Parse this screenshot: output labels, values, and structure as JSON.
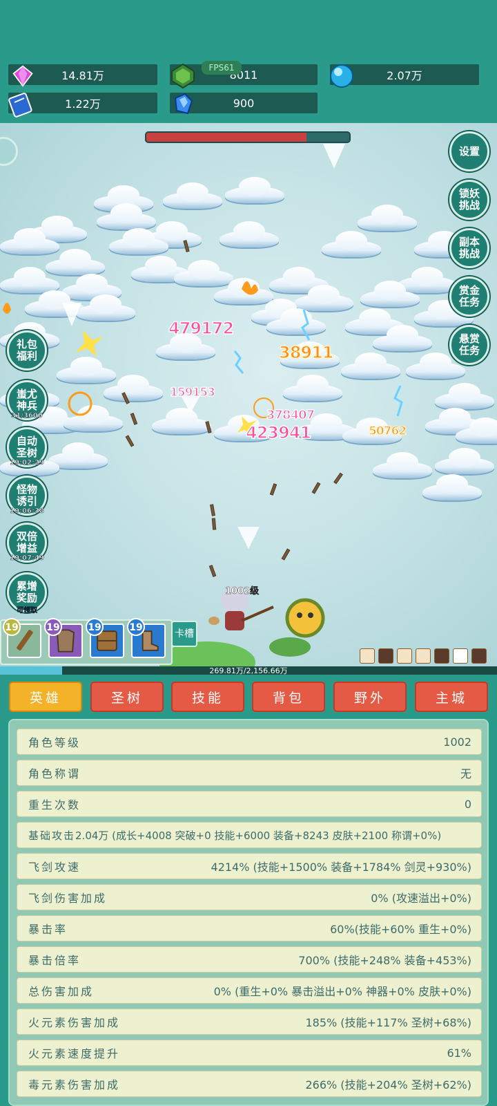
{
  "resources": [
    {
      "name": "diamond",
      "value": "14.81万",
      "icon": "gem-purple-icon"
    },
    {
      "name": "green-crystal",
      "value": "8011",
      "icon": "gem-green-icon"
    },
    {
      "name": "orb",
      "value": "2.07万",
      "icon": "orb-blue-icon"
    },
    {
      "name": "book",
      "value": "1.22万",
      "icon": "book-icon"
    },
    {
      "name": "blue-crystal",
      "value": "900",
      "icon": "crystal-blue-icon"
    }
  ],
  "fps": "FPS61",
  "boss_hp_fraction": 0.79,
  "damage_numbers": [
    "479172",
    "38911",
    "159153",
    "378407",
    "423941",
    "50762"
  ],
  "side_buttons_left": [
    {
      "label_1": "礼包",
      "label_2": "福利",
      "timer": ""
    },
    {
      "label_1": "蚩尤",
      "label_2": "神兵",
      "timer": "31/3600"
    },
    {
      "label_1": "自动",
      "label_2": "圣树",
      "timer": "19:02:29"
    },
    {
      "label_1": "怪物",
      "label_2": "诱引",
      "timer": "19:06:38"
    },
    {
      "label_1": "双倍",
      "label_2": "增益",
      "timer": "19:07:49"
    },
    {
      "label_1": "累增",
      "label_2": "奖励",
      "timer": "可领取"
    }
  ],
  "side_buttons_right": [
    {
      "label_1": "设置",
      "label_2": ""
    },
    {
      "label_1": "锁妖",
      "label_2": "挑战"
    },
    {
      "label_1": "副本",
      "label_2": "挑战"
    },
    {
      "label_1": "赏金",
      "label_2": "任务"
    },
    {
      "label_1": "悬赏",
      "label_2": "任务"
    }
  ],
  "player_level": "1002级",
  "equip_slots": [
    {
      "level": "19",
      "icon": "wooden-sword-icon"
    },
    {
      "level": "19",
      "icon": "armor-icon"
    },
    {
      "level": "19",
      "icon": "shield-icon"
    },
    {
      "level": "19",
      "icon": "boots-icon"
    }
  ],
  "card_slot_label": "卡槽",
  "exp_progress": "269.81万/2,156.66万",
  "exp_fraction": 0.125,
  "tabs": [
    {
      "label": "英雄",
      "active": true
    },
    {
      "label": "圣树",
      "active": false
    },
    {
      "label": "技能",
      "active": false
    },
    {
      "label": "背包",
      "active": false
    },
    {
      "label": "野外",
      "active": false
    },
    {
      "label": "主城",
      "active": false
    }
  ],
  "stats": [
    {
      "label": "角色等级",
      "value": "1002"
    },
    {
      "label": "角色称谓",
      "value": "无"
    },
    {
      "label": "重生次数",
      "value": "0"
    },
    {
      "label": "基础攻击",
      "value": "2.04万 (成长+4008 突破+0 技能+6000 装备+8243 皮肤+2100 称谓+0%)"
    },
    {
      "label": "飞剑攻速",
      "value": "4214% (技能+1500% 装备+1784% 剑灵+930%)"
    },
    {
      "label": "飞剑伤害加成",
      "value": "0% (攻速溢出+0%)"
    },
    {
      "label": "暴击率",
      "value": "60%(技能+60% 重生+0%)"
    },
    {
      "label": "暴击倍率",
      "value": "700% (技能+248% 装备+453%)"
    },
    {
      "label": "总伤害加成",
      "value": "0% (重生+0% 暴击溢出+0% 神器+0% 皮肤+0%)"
    },
    {
      "label": "火元素伤害加成",
      "value": "185% (技能+117% 圣树+68%)"
    },
    {
      "label": "火元素速度提升",
      "value": "61%"
    },
    {
      "label": "毒元素伤害加成",
      "value": "266% (技能+204% 圣树+62%)"
    }
  ]
}
